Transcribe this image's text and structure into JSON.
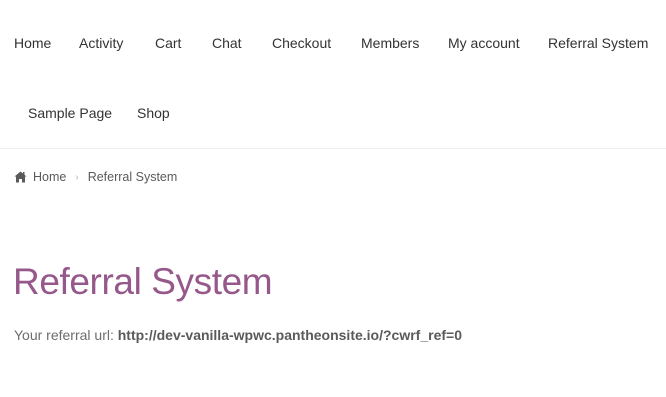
{
  "nav": {
    "items": [
      {
        "label": "Home"
      },
      {
        "label": "Activity"
      },
      {
        "label": "Cart"
      },
      {
        "label": "Chat"
      },
      {
        "label": "Checkout"
      },
      {
        "label": "Members"
      },
      {
        "label": "My account"
      },
      {
        "label": "Referral System"
      },
      {
        "label": "Sample Page"
      },
      {
        "label": "Shop"
      }
    ]
  },
  "breadcrumb": {
    "home_icon": "home-icon",
    "home_label": "Home",
    "separator": "›",
    "current": "Referral System"
  },
  "page": {
    "title": "Referral System",
    "referral_label": "Your referral url:",
    "referral_url": "http://dev-vanilla-wpwc.pantheonsite.io/?cwrf_ref=0"
  },
  "colors": {
    "title": "#96588a",
    "text": "#6d6d6d",
    "nav_text": "#333333",
    "divider": "#eeeeee"
  }
}
